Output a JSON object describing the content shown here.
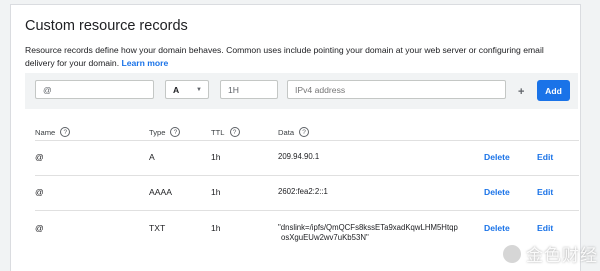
{
  "section": {
    "title": "Custom resource records",
    "description": "Resource records define how your domain behaves. Common uses include pointing your domain at your web server or configuring email delivery for your domain.",
    "learn_more": "Learn more"
  },
  "form": {
    "name_value": "@",
    "type_value": "A",
    "ttl_value": "1H",
    "data_placeholder": "IPv4 address",
    "plus": "+",
    "add_label": "Add"
  },
  "table": {
    "headers": {
      "name": "Name",
      "type": "Type",
      "ttl": "TTL",
      "data": "Data"
    },
    "help_glyph": "?",
    "rows": [
      {
        "name": "@",
        "type": "A",
        "ttl": "1h",
        "data_line1": "209.94.90.1",
        "data_line2": "",
        "delete": "Delete",
        "edit": "Edit"
      },
      {
        "name": "@",
        "type": "AAAA",
        "ttl": "1h",
        "data_line1": "2602:fea2:2::1",
        "data_line2": "",
        "delete": "Delete",
        "edit": "Edit"
      },
      {
        "name": "@",
        "type": "TXT",
        "ttl": "1h",
        "data_line1": "\"dnslink=/ipfs/QmQCFs8kssETa9xadKqwLHM5Htqp",
        "data_line2": "osXguEUw2wv7uKb53N\"",
        "delete": "Delete",
        "edit": "Edit"
      }
    ]
  },
  "watermark": {
    "text": "金色财经"
  },
  "colors": {
    "accent": "#1a73e8",
    "border": "#dadce0",
    "form_bg": "#f1f3f4"
  }
}
